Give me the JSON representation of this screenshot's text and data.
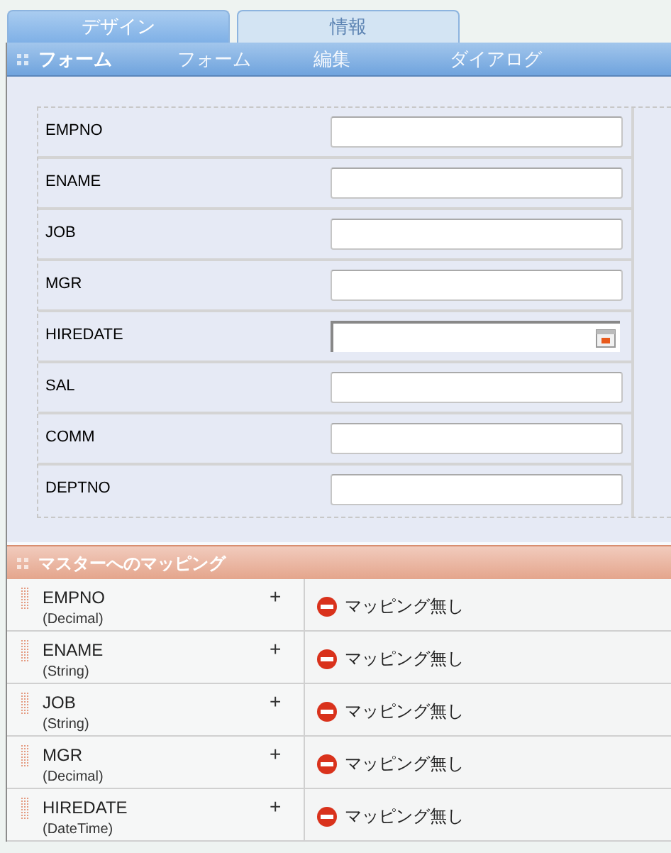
{
  "tabs": [
    {
      "label": "デザイン",
      "selected": true
    },
    {
      "label": "情報",
      "selected": false
    }
  ],
  "toolbar": {
    "title": "フォーム",
    "menu": [
      "フォーム",
      "編集",
      "ダイアログ"
    ]
  },
  "form": {
    "fields": [
      {
        "label": "EMPNO",
        "kind": "text"
      },
      {
        "label": "ENAME",
        "kind": "text"
      },
      {
        "label": "JOB",
        "kind": "text"
      },
      {
        "label": "MGR",
        "kind": "text"
      },
      {
        "label": "HIREDATE",
        "kind": "date"
      },
      {
        "label": "SAL",
        "kind": "text"
      },
      {
        "label": "COMM",
        "kind": "text"
      },
      {
        "label": "DEPTNO",
        "kind": "text"
      }
    ]
  },
  "mapping": {
    "title": "マスターへのマッピング",
    "rows": [
      {
        "name": "EMPNO",
        "type": "(Decimal)",
        "add": "+",
        "status": "マッピング無し"
      },
      {
        "name": "ENAME",
        "type": "(String)",
        "add": "+",
        "status": "マッピング無し"
      },
      {
        "name": "JOB",
        "type": "(String)",
        "add": "+",
        "status": "マッピング無し"
      },
      {
        "name": "MGR",
        "type": "(Decimal)",
        "add": "+",
        "status": "マッピング無し"
      },
      {
        "name": "HIREDATE",
        "type": "(DateTime)",
        "add": "+",
        "status": "マッピング無し"
      }
    ]
  }
}
